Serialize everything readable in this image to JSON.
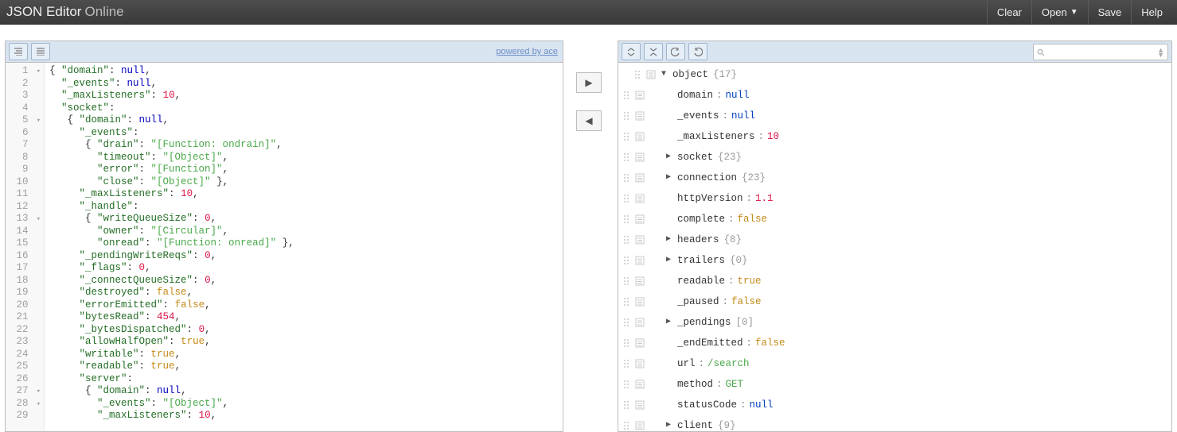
{
  "brand": {
    "main": "JSON Editor",
    "sub": "Online"
  },
  "header_buttons": {
    "clear": "Clear",
    "open": "Open",
    "save": "Save",
    "help": "Help"
  },
  "left": {
    "credit": "powered by ace",
    "lines": [
      {
        "n": 1,
        "fold": "▾",
        "segs": [
          [
            "p",
            "{ "
          ],
          [
            "keyq",
            "\"domain\""
          ],
          [
            "p",
            ": "
          ],
          [
            "nul",
            "null"
          ],
          [
            "p",
            ","
          ]
        ]
      },
      {
        "n": 2,
        "segs": [
          [
            "p",
            "  "
          ],
          [
            "keyq",
            "\"_events\""
          ],
          [
            "p",
            ": "
          ],
          [
            "nul",
            "null"
          ],
          [
            "p",
            ","
          ]
        ]
      },
      {
        "n": 3,
        "segs": [
          [
            "p",
            "  "
          ],
          [
            "keyq",
            "\"_maxListeners\""
          ],
          [
            "p",
            ": "
          ],
          [
            "num",
            "10"
          ],
          [
            "p",
            ","
          ]
        ]
      },
      {
        "n": 4,
        "segs": [
          [
            "p",
            "  "
          ],
          [
            "keyq",
            "\"socket\""
          ],
          [
            "p",
            ":"
          ]
        ]
      },
      {
        "n": 5,
        "fold": "▾",
        "segs": [
          [
            "p",
            "   { "
          ],
          [
            "keyq",
            "\"domain\""
          ],
          [
            "p",
            ": "
          ],
          [
            "nul",
            "null"
          ],
          [
            "p",
            ","
          ]
        ]
      },
      {
        "n": 6,
        "segs": [
          [
            "p",
            "     "
          ],
          [
            "keyq",
            "\"_events\""
          ],
          [
            "p",
            ":"
          ]
        ]
      },
      {
        "n": 7,
        "segs": [
          [
            "p",
            "      { "
          ],
          [
            "keyq",
            "\"drain\""
          ],
          [
            "p",
            ": "
          ],
          [
            "str",
            "\"[Function: ondrain]\""
          ],
          [
            "p",
            ","
          ]
        ]
      },
      {
        "n": 8,
        "segs": [
          [
            "p",
            "        "
          ],
          [
            "keyq",
            "\"timeout\""
          ],
          [
            "p",
            ": "
          ],
          [
            "str",
            "\"[Object]\""
          ],
          [
            "p",
            ","
          ]
        ]
      },
      {
        "n": 9,
        "segs": [
          [
            "p",
            "        "
          ],
          [
            "keyq",
            "\"error\""
          ],
          [
            "p",
            ": "
          ],
          [
            "str",
            "\"[Function]\""
          ],
          [
            "p",
            ","
          ]
        ]
      },
      {
        "n": 10,
        "segs": [
          [
            "p",
            "        "
          ],
          [
            "keyq",
            "\"close\""
          ],
          [
            "p",
            ": "
          ],
          [
            "str",
            "\"[Object]\""
          ],
          [
            "p",
            " },"
          ]
        ]
      },
      {
        "n": 11,
        "segs": [
          [
            "p",
            "     "
          ],
          [
            "keyq",
            "\"_maxListeners\""
          ],
          [
            "p",
            ": "
          ],
          [
            "num",
            "10"
          ],
          [
            "p",
            ","
          ]
        ]
      },
      {
        "n": 12,
        "segs": [
          [
            "p",
            "     "
          ],
          [
            "keyq",
            "\"_handle\""
          ],
          [
            "p",
            ":"
          ]
        ]
      },
      {
        "n": 13,
        "fold": "▾",
        "segs": [
          [
            "p",
            "      { "
          ],
          [
            "keyq",
            "\"writeQueueSize\""
          ],
          [
            "p",
            ": "
          ],
          [
            "num",
            "0"
          ],
          [
            "p",
            ","
          ]
        ]
      },
      {
        "n": 14,
        "segs": [
          [
            "p",
            "        "
          ],
          [
            "keyq",
            "\"owner\""
          ],
          [
            "p",
            ": "
          ],
          [
            "str",
            "\"[Circular]\""
          ],
          [
            "p",
            ","
          ]
        ]
      },
      {
        "n": 15,
        "segs": [
          [
            "p",
            "        "
          ],
          [
            "keyq",
            "\"onread\""
          ],
          [
            "p",
            ": "
          ],
          [
            "str",
            "\"[Function: onread]\""
          ],
          [
            "p",
            " },"
          ]
        ]
      },
      {
        "n": 16,
        "segs": [
          [
            "p",
            "     "
          ],
          [
            "keyq",
            "\"_pendingWriteReqs\""
          ],
          [
            "p",
            ": "
          ],
          [
            "num",
            "0"
          ],
          [
            "p",
            ","
          ]
        ]
      },
      {
        "n": 17,
        "segs": [
          [
            "p",
            "     "
          ],
          [
            "keyq",
            "\"_flags\""
          ],
          [
            "p",
            ": "
          ],
          [
            "num",
            "0"
          ],
          [
            "p",
            ","
          ]
        ]
      },
      {
        "n": 18,
        "segs": [
          [
            "p",
            "     "
          ],
          [
            "keyq",
            "\"_connectQueueSize\""
          ],
          [
            "p",
            ": "
          ],
          [
            "num",
            "0"
          ],
          [
            "p",
            ","
          ]
        ]
      },
      {
        "n": 19,
        "segs": [
          [
            "p",
            "     "
          ],
          [
            "keyq",
            "\"destroyed\""
          ],
          [
            "p",
            ": "
          ],
          [
            "bool",
            "false"
          ],
          [
            "p",
            ","
          ]
        ]
      },
      {
        "n": 20,
        "segs": [
          [
            "p",
            "     "
          ],
          [
            "keyq",
            "\"errorEmitted\""
          ],
          [
            "p",
            ": "
          ],
          [
            "bool",
            "false"
          ],
          [
            "p",
            ","
          ]
        ]
      },
      {
        "n": 21,
        "segs": [
          [
            "p",
            "     "
          ],
          [
            "keyq",
            "\"bytesRead\""
          ],
          [
            "p",
            ": "
          ],
          [
            "num",
            "454"
          ],
          [
            "p",
            ","
          ]
        ]
      },
      {
        "n": 22,
        "segs": [
          [
            "p",
            "     "
          ],
          [
            "keyq",
            "\"_bytesDispatched\""
          ],
          [
            "p",
            ": "
          ],
          [
            "num",
            "0"
          ],
          [
            "p",
            ","
          ]
        ]
      },
      {
        "n": 23,
        "segs": [
          [
            "p",
            "     "
          ],
          [
            "keyq",
            "\"allowHalfOpen\""
          ],
          [
            "p",
            ": "
          ],
          [
            "bool",
            "true"
          ],
          [
            "p",
            ","
          ]
        ]
      },
      {
        "n": 24,
        "segs": [
          [
            "p",
            "     "
          ],
          [
            "keyq",
            "\"writable\""
          ],
          [
            "p",
            ": "
          ],
          [
            "bool",
            "true"
          ],
          [
            "p",
            ","
          ]
        ]
      },
      {
        "n": 25,
        "segs": [
          [
            "p",
            "     "
          ],
          [
            "keyq",
            "\"readable\""
          ],
          [
            "p",
            ": "
          ],
          [
            "bool",
            "true"
          ],
          [
            "p",
            ","
          ]
        ]
      },
      {
        "n": 26,
        "segs": [
          [
            "p",
            "     "
          ],
          [
            "keyq",
            "\"server\""
          ],
          [
            "p",
            ":"
          ]
        ]
      },
      {
        "n": 27,
        "fold": "▾",
        "segs": [
          [
            "p",
            "      { "
          ],
          [
            "keyq",
            "\"domain\""
          ],
          [
            "p",
            ": "
          ],
          [
            "nul",
            "null"
          ],
          [
            "p",
            ","
          ]
        ]
      },
      {
        "n": 28,
        "fold": "▾",
        "segs": [
          [
            "p",
            "        "
          ],
          [
            "keyq",
            "\"_events\""
          ],
          [
            "p",
            ": "
          ],
          [
            "str",
            "\"[Object]\""
          ],
          [
            "p",
            ","
          ]
        ]
      },
      {
        "n": 29,
        "segs": [
          [
            "p",
            "        "
          ],
          [
            "keyq",
            "\"_maxListeners\""
          ],
          [
            "p",
            ": "
          ],
          [
            "num",
            "10"
          ],
          [
            "p",
            ","
          ]
        ]
      }
    ]
  },
  "tree": {
    "root": {
      "label": "object",
      "meta": "{17}"
    },
    "rows": [
      {
        "depth": 1,
        "key": "domain",
        "vtype": "null",
        "val": "null"
      },
      {
        "depth": 1,
        "key": "_events",
        "vtype": "null",
        "val": "null"
      },
      {
        "depth": 1,
        "key": "_maxListeners",
        "vtype": "num",
        "val": "10"
      },
      {
        "depth": 1,
        "key": "socket",
        "meta": "{23}",
        "exp": "▶"
      },
      {
        "depth": 1,
        "key": "connection",
        "meta": "{23}",
        "exp": "▶"
      },
      {
        "depth": 1,
        "key": "httpVersion",
        "vtype": "num",
        "val": "1.1"
      },
      {
        "depth": 1,
        "key": "complete",
        "vtype": "bool",
        "val": "false"
      },
      {
        "depth": 1,
        "key": "headers",
        "meta": "{8}",
        "exp": "▶"
      },
      {
        "depth": 1,
        "key": "trailers",
        "meta": "{0}",
        "exp": "▶"
      },
      {
        "depth": 1,
        "key": "readable",
        "vtype": "bool",
        "val": "true"
      },
      {
        "depth": 1,
        "key": "_paused",
        "vtype": "bool",
        "val": "false"
      },
      {
        "depth": 1,
        "key": "_pendings",
        "meta": "[0]",
        "exp": "▶"
      },
      {
        "depth": 1,
        "key": "_endEmitted",
        "vtype": "bool",
        "val": "false"
      },
      {
        "depth": 1,
        "key": "url",
        "vtype": "str",
        "val": "/search"
      },
      {
        "depth": 1,
        "key": "method",
        "vtype": "str",
        "val": "GET"
      },
      {
        "depth": 1,
        "key": "statusCode",
        "vtype": "null",
        "val": "null"
      },
      {
        "depth": 1,
        "key": "client",
        "meta": "{9}",
        "exp": "▶"
      }
    ]
  },
  "search": {
    "placeholder": ""
  }
}
